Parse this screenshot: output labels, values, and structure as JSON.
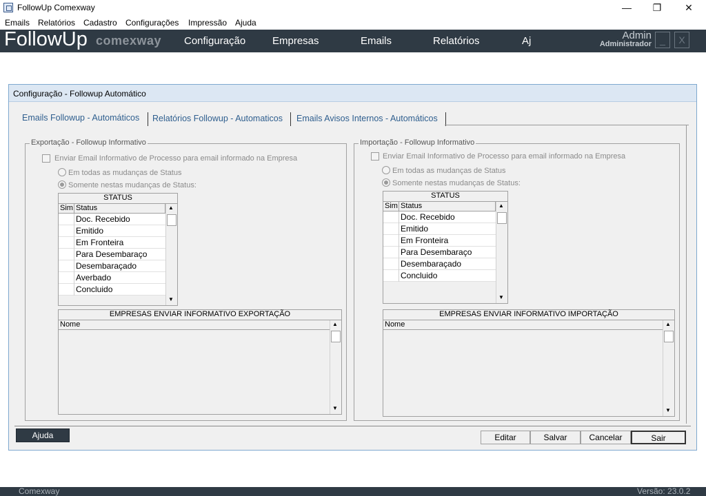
{
  "window": {
    "title": "FollowUp Comexway",
    "min": "—",
    "max": "❐",
    "close": "✕"
  },
  "menu": [
    "Emails",
    "Relatórios",
    "Cadastro",
    "Configurações",
    "Impressão",
    "Ajuda"
  ],
  "nav": {
    "brand": "FollowUp",
    "brand_sub": "comexway",
    "items": [
      "Configuração",
      "Empresas",
      "Emails",
      "Relatórios",
      "Aj"
    ],
    "user": "Admin",
    "role": "Administrador",
    "min_btn": "_",
    "close_btn": "X"
  },
  "dialog": {
    "title": "Configuração - Followup Automático",
    "tabs": [
      "Emails Followup - Automáticos",
      "Relatórios Followup - Automaticos",
      "Emails Avisos Internos - Automáticos"
    ],
    "export": {
      "group_label": "Exportação - Followup Informativo",
      "checkbox_label": "Enviar Email Informativo de Processo para email informado na Empresa",
      "radio_all": "Em todas as mudanças de Status",
      "radio_some": "Somente nestas mudanças de Status:",
      "status_title": "STATUS",
      "col_sim": "Sim",
      "col_status": "Status",
      "statuses": [
        "Doc. Recebido",
        "Emitido",
        "Em Fronteira",
        "Para Desembaraço",
        "Desembaraçado",
        "Averbado",
        "Concluido"
      ],
      "companies_title": "EMPRESAS ENVIAR INFORMATIVO EXPORTAÇÃO",
      "col_nome": "Nome"
    },
    "import": {
      "group_label": "Importação - Followup Informativo",
      "checkbox_label": "Enviar Email Informativo de Processo para email informado na Empresa",
      "radio_all": "Em todas as mudanças de Status",
      "radio_some": "Somente nestas mudanças de Status:",
      "status_title": "STATUS",
      "col_sim": "Sim",
      "col_status": "Status",
      "statuses": [
        "Doc. Recebido",
        "Emitido",
        "Em Fronteira",
        "Para Desembaraço",
        "Desembaraçado",
        "Concluido"
      ],
      "companies_title": "EMPRESAS ENVIAR INFORMATIVO IMPORTAÇÃO",
      "col_nome": "Nome"
    },
    "buttons": {
      "help": "Ajuda",
      "edit": "Editar",
      "save": "Salvar",
      "cancel": "Cancelar",
      "exit": "Sair"
    }
  },
  "status": {
    "left": "Comexway",
    "right": "Versão: 23.0.2"
  }
}
